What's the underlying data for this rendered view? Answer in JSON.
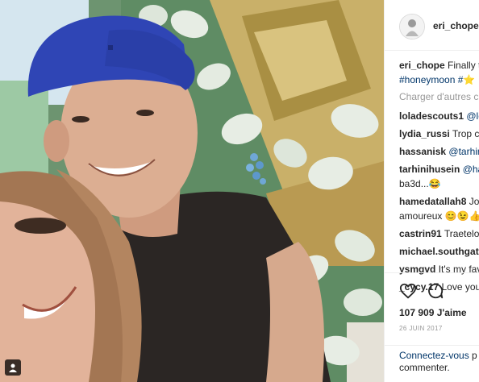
{
  "post": {
    "username": "eri_chope",
    "caption_user": "eri_chope",
    "caption_text": " Finally t",
    "caption_tags": "#honeymoon #",
    "caption_emoji": "⭐",
    "load_more": "Charger d'autres c",
    "likes": "107 909 J'aime",
    "date": "26 JUIN 2017",
    "login_link": "Connectez-vous",
    "login_rest": " p",
    "login_line2": "commenter."
  },
  "comments": [
    {
      "user": "loladescouts1",
      "mention": "@le",
      "text": ""
    },
    {
      "user": "lydia_russi",
      "mention": "",
      "text": " Trop cl"
    },
    {
      "user": "hassanisk",
      "mention": "@tarhin",
      "text": ""
    },
    {
      "user": "tarhinihusein",
      "mention": "@ha",
      "text": "",
      "line2": "ba3d...😂"
    },
    {
      "user": "hamedatallah8",
      "mention": "",
      "text": " Jo",
      "line2": "amoureux 😊😉👍"
    },
    {
      "user": "castrin91",
      "mention": "",
      "text": " Traetelo"
    },
    {
      "user": "michael.southgat",
      "mention": "",
      "text": ""
    },
    {
      "user": "ysmgvd",
      "mention": "",
      "text": " It's my fav"
    },
    {
      "user": "_cycy.17",
      "mention": "",
      "text": " Love you"
    }
  ],
  "icons": {
    "like": "heart-icon",
    "comment": "comment-bubble-icon",
    "gallery": "user-tag-icon",
    "avatar": "profile-avatar"
  },
  "colors": {
    "text": "#262626",
    "link": "#003569",
    "muted": "#999999",
    "border": "#efefef"
  }
}
